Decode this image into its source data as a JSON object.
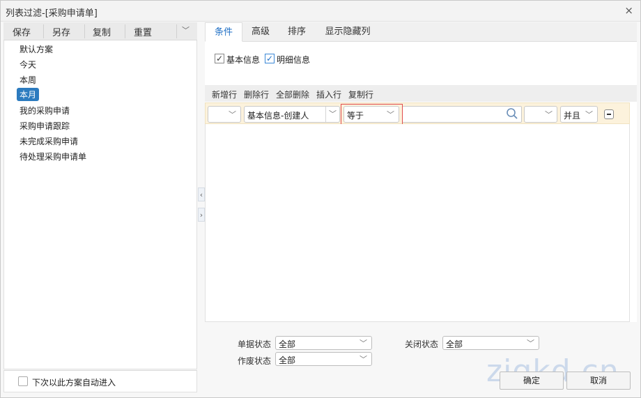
{
  "window": {
    "title": "列表过滤-[采购申请单]",
    "close_glyph": "×"
  },
  "left_toolbar": {
    "save": "保存",
    "save_as": "另存",
    "copy": "复制",
    "reset": "重置",
    "dropdown_glyph": "﹀"
  },
  "schemes": [
    "默认方案",
    "今天",
    "本周",
    "本月",
    "我的采购申请",
    "采购申请跟踪",
    "未完成采购申请",
    "待处理采购申请单"
  ],
  "selected_scheme": "本月",
  "left_footer": {
    "auto_enter_label": "下次以此方案自动进入"
  },
  "splitter": {
    "left": "‹",
    "right": "›"
  },
  "tabs": [
    "条件",
    "高级",
    "排序",
    "显示隐藏列"
  ],
  "active_tab": "条件",
  "checks": {
    "basic_info": "基本信息",
    "detail_info": "明细信息",
    "check_glyph": "✓"
  },
  "row_actions": [
    "新增行",
    "删除行",
    "全部删除",
    "插入行",
    "复制行"
  ],
  "condition_row": {
    "bracket_left": "",
    "field": "基本信息-创建人",
    "operator": "等于",
    "value": "",
    "bracket_right": "",
    "logic": "并且",
    "chevron": "﹀"
  },
  "filters": {
    "doc_status": {
      "label": "单据状态",
      "value": "全部"
    },
    "close_status": {
      "label": "关闭状态",
      "value": "全部"
    },
    "void_status": {
      "label": "作废状态",
      "value": "全部"
    }
  },
  "buttons": {
    "ok": "确定",
    "cancel": "取消"
  },
  "watermark": "zjgkd.cn",
  "colors": {
    "accent": "#1f6fc5",
    "selected_bg": "#2c7bbf",
    "row_bg": "#fcf2dc",
    "highlight": "#e14b4b"
  }
}
